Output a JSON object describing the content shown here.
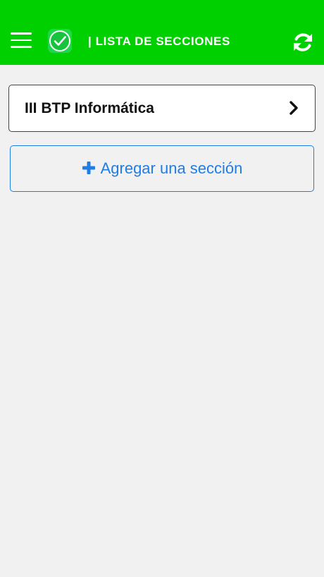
{
  "header": {
    "title": "| LISTA DE SECCIONES",
    "background_color": "#00d000",
    "menu_icon": "hamburger-menu-icon",
    "logo_icon": "check-shield-logo",
    "refresh_icon": "refresh-icon"
  },
  "sections": [
    {
      "name": "III BTP Informática",
      "icon": "chevron-right-icon"
    }
  ],
  "add_section": {
    "label": "Agregar una sección",
    "icon": "plus-icon",
    "color": "#1e7ee6"
  }
}
